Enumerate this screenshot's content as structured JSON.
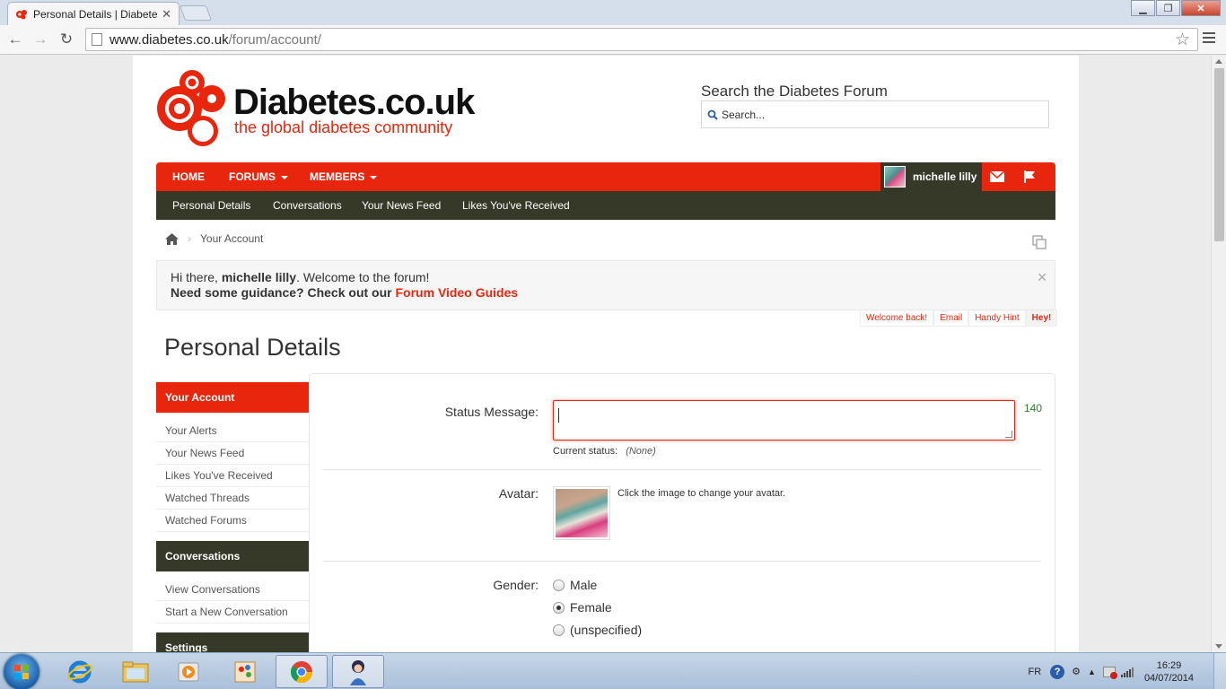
{
  "browser": {
    "tab_title": "Personal Details | Diabetes",
    "url_host": "www.diabetes.co.uk",
    "url_path": "/forum/account/"
  },
  "header": {
    "logo_title": "Diabetes.co.uk",
    "logo_tagline": "the global diabetes community",
    "search_label": "Search the Diabetes Forum",
    "search_placeholder": "Search..."
  },
  "nav": {
    "home": "HOME",
    "forums": "FORUMS",
    "members": "MEMBERS",
    "username": "michelle lilly"
  },
  "subnav": {
    "items": [
      "Personal Details",
      "Conversations",
      "Your News Feed",
      "Likes You've Received"
    ]
  },
  "breadcrumb": {
    "current": "Your Account"
  },
  "notice": {
    "greeting_prefix": "Hi there,",
    "username": "michelle lilly",
    "greeting_suffix": ". Welcome to the forum!",
    "guidance": "Need some guidance? Check out our",
    "guidance_link": "Forum Video Guides",
    "tabs": [
      "Welcome back!",
      "Email",
      "Handy Hint",
      "Hey!"
    ]
  },
  "page_title": "Personal Details",
  "sidebar": {
    "your_account": {
      "heading": "Your Account",
      "items": [
        "Your Alerts",
        "Your News Feed",
        "Likes You've Received",
        "Watched Threads",
        "Watched Forums"
      ]
    },
    "conversations": {
      "heading": "Conversations",
      "items": [
        "View Conversations",
        "Start a New Conversation"
      ]
    },
    "settings": {
      "heading": "Settings"
    }
  },
  "form": {
    "status_label": "Status Message:",
    "status_value": "",
    "status_counter": "140",
    "current_status_label": "Current status:",
    "current_status_value": "(None)",
    "avatar_label": "Avatar:",
    "avatar_hint": "Click the image to change your avatar.",
    "gender_label": "Gender:",
    "gender_options": [
      "Male",
      "Female",
      "(unspecified)"
    ],
    "gender_selected": "Female"
  },
  "taskbar": {
    "language": "FR",
    "time": "16:29",
    "date": "04/07/2014"
  },
  "colors": {
    "brand_red": "#e8260d",
    "dark_olive": "#373928",
    "counter_green": "#2a7d2a"
  }
}
